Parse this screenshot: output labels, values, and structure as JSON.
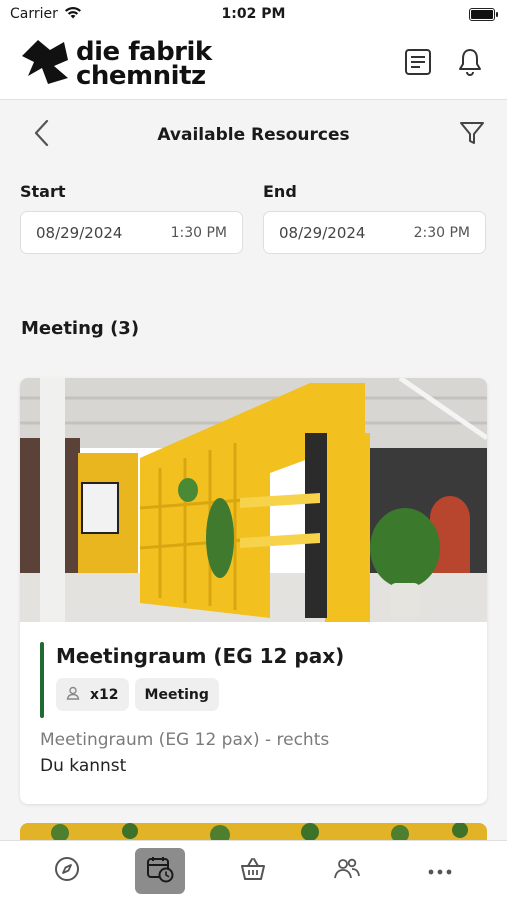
{
  "status_bar": {
    "carrier": "Carrier",
    "time": "1:02 PM"
  },
  "brand": {
    "line1": "die fabrik",
    "line2": "chemnitz"
  },
  "nav": {
    "title": "Available Resources"
  },
  "range": {
    "start_label": "Start",
    "start_date": "08/29/2024",
    "start_time": "1:30 PM",
    "end_label": "End",
    "end_date": "08/29/2024",
    "end_time": "2:30 PM"
  },
  "section": {
    "title": "Meeting (3)"
  },
  "card": {
    "title": "Meetingraum (EG 12 pax)",
    "capacity": "x12",
    "category": "Meeting",
    "subtitle": "Meetingraum (EG 12 pax) - rechts",
    "description": "Du kannst",
    "accent_color": "#1e6b33"
  },
  "tabs": [
    {
      "icon": "compass-icon",
      "active": false
    },
    {
      "icon": "calendar-clock-icon",
      "active": true
    },
    {
      "icon": "basket-icon",
      "active": false
    },
    {
      "icon": "people-icon",
      "active": false
    },
    {
      "icon": "more-icon",
      "active": false
    }
  ],
  "colors": {
    "accent_green": "#1e6b33",
    "room_yellow": "#f2c01f",
    "active_tab": "#8c8c8c"
  }
}
